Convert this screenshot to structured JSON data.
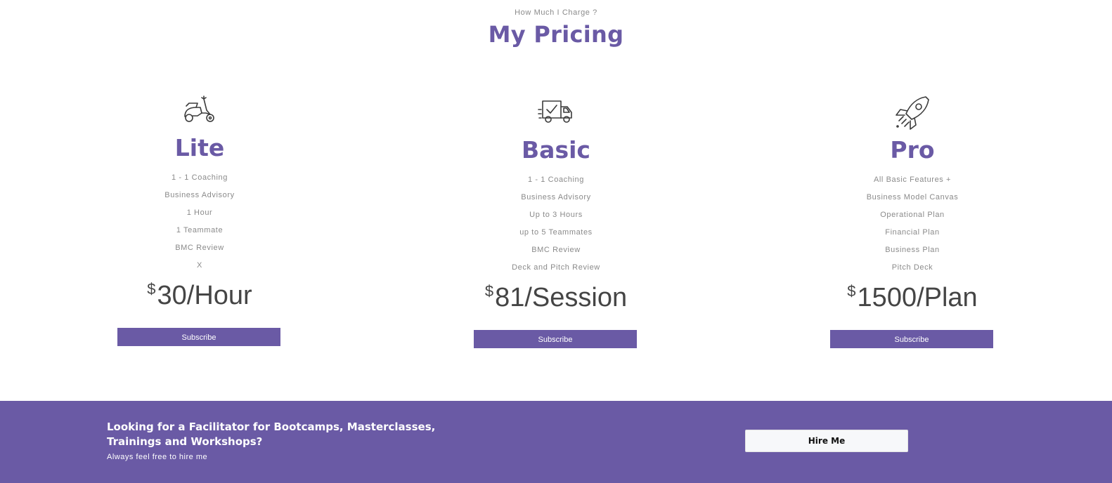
{
  "header": {
    "eyebrow": "How Much I Charge ?",
    "title": "My Pricing"
  },
  "plans": [
    {
      "icon": "scooter-icon",
      "name": "Lite",
      "features": [
        "1 - 1 Coaching",
        "Business Advisory",
        "1 Hour",
        "1 Teammate",
        "BMC Review",
        "X"
      ],
      "currency": "$",
      "price": "30/Hour",
      "button": "Subscribe"
    },
    {
      "icon": "delivery-truck-icon",
      "name": "Basic",
      "features": [
        "1 - 1 Coaching",
        "Business Advisory",
        "Up to 3 Hours",
        "up to 5 Teammates",
        "BMC Review",
        "Deck and Pitch Review"
      ],
      "currency": "$",
      "price": "81/Session",
      "button": "Subscribe"
    },
    {
      "icon": "rocket-icon",
      "name": "Pro",
      "features": [
        "All Basic Features +",
        "Business Model Canvas",
        "Operational Plan",
        "Financial Plan",
        "Business Plan",
        "Pitch Deck"
      ],
      "currency": "$",
      "price": "1500/Plan",
      "button": "Subscribe"
    }
  ],
  "cta": {
    "title": "Looking for a Facilitator for Bootcamps, Masterclasses, Trainings and Workshops?",
    "subtitle": "Always feel free to hire me",
    "button": "Hire Me"
  },
  "colors": {
    "accent": "#6a5aa5",
    "price_text": "#454545",
    "muted_text": "#8a8a8a"
  }
}
